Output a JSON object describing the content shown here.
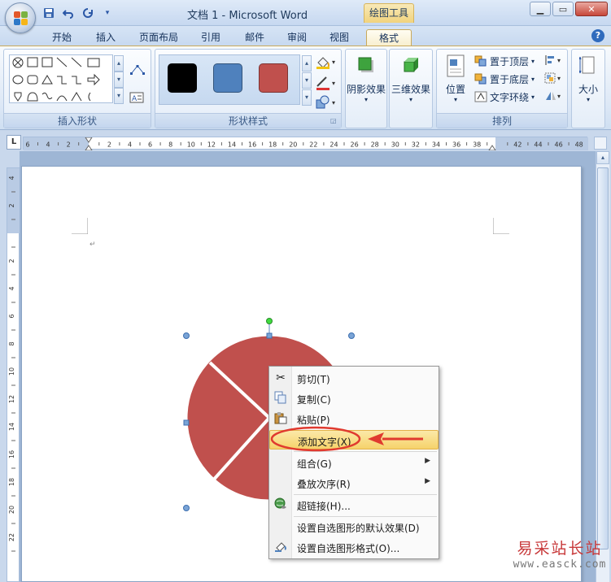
{
  "window": {
    "title": "文档 1 - Microsoft Word",
    "contextual_tab_group": "绘图工具",
    "controls": [
      "minimize",
      "maximize",
      "close"
    ]
  },
  "quick_access": [
    "save-icon",
    "undo-icon",
    "redo-icon",
    "customize-icon"
  ],
  "tabs": [
    {
      "label": "开始",
      "active": false
    },
    {
      "label": "插入",
      "active": false
    },
    {
      "label": "页面布局",
      "active": false
    },
    {
      "label": "引用",
      "active": false
    },
    {
      "label": "邮件",
      "active": false
    },
    {
      "label": "审阅",
      "active": false
    },
    {
      "label": "视图",
      "active": false
    },
    {
      "label": "格式",
      "active": true
    }
  ],
  "ribbon": {
    "insert_shapes": {
      "label": "插入形状"
    },
    "shape_styles": {
      "label": "形状样式",
      "swatches": [
        "#000000",
        "#4f81bd",
        "#c0504d"
      ]
    },
    "shadow": {
      "label": "阴影效果"
    },
    "threed": {
      "label": "三维效果"
    },
    "arrange": {
      "label": "排列",
      "position": "位置",
      "bring_front": "置于顶层",
      "send_back": "置于底层",
      "wrap_text": "文字环绕"
    },
    "size": {
      "label": "大小"
    }
  },
  "ruler": {
    "h_ticks": [
      "6",
      "4",
      "2",
      "",
      "2",
      "4",
      "6",
      "8",
      "10",
      "12",
      "14",
      "16",
      "18",
      "20",
      "22",
      "24",
      "26",
      "28",
      "30",
      "32",
      "34",
      "36",
      "38",
      "",
      "42",
      "44",
      "46",
      "48"
    ],
    "v_ticks": [
      "4",
      "2",
      "",
      "2",
      "4",
      "6",
      "8",
      "10",
      "12",
      "14",
      "16",
      "18",
      "20",
      "22"
    ]
  },
  "context_menu": {
    "items": [
      {
        "label": "剪切(T)",
        "icon": "scissors-icon",
        "submenu": false
      },
      {
        "label": "复制(C)",
        "icon": "copy-icon",
        "submenu": false
      },
      {
        "label": "粘贴(P)",
        "icon": "paste-icon",
        "submenu": false
      },
      {
        "label": "添加文字(X)",
        "icon": "",
        "submenu": false,
        "highlighted": true
      },
      {
        "label": "组合(G)",
        "icon": "",
        "submenu": true
      },
      {
        "label": "叠放次序(R)",
        "icon": "",
        "submenu": true
      },
      {
        "label": "超链接(H)...",
        "icon": "hyperlink-icon",
        "submenu": false
      },
      {
        "label": "设置自选图形的默认效果(D)",
        "icon": "",
        "submenu": false
      },
      {
        "label": "设置自选图形格式(O)...",
        "icon": "format-shape-icon",
        "submenu": false
      }
    ]
  },
  "shape": {
    "fill": "#c0504d",
    "outline": "#ffffff"
  },
  "watermark": {
    "cn": "易采站长站",
    "url": "www.easck.com"
  },
  "colors": {
    "annotation_red": "#e03a2f",
    "highlight": "#f6d36b"
  }
}
